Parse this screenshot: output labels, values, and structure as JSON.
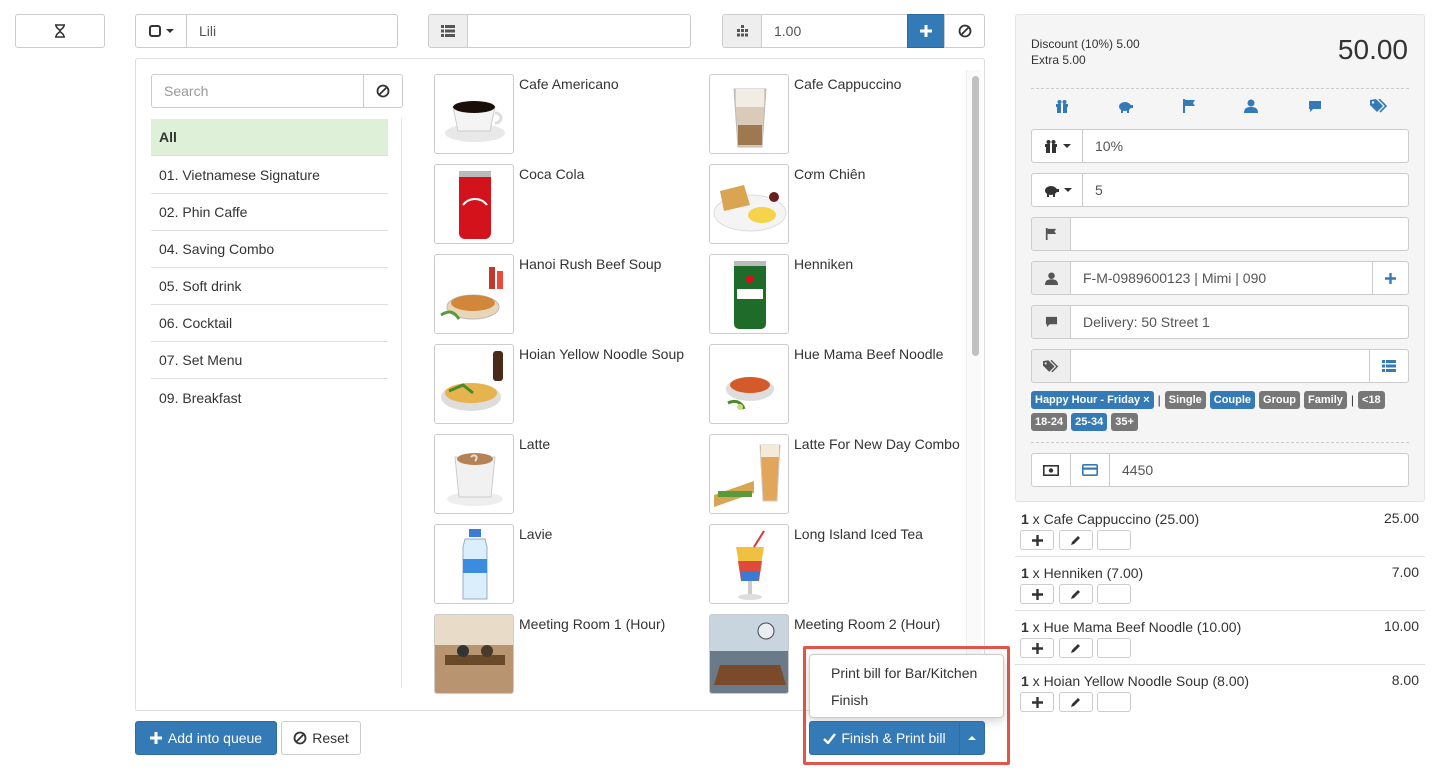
{
  "top": {
    "customer_value": "Lili",
    "table_value": "",
    "quantity_value": "1.00"
  },
  "search": {
    "placeholder": "Search"
  },
  "categories": [
    {
      "label": "All"
    },
    {
      "label": "01. Vietnamese Signature"
    },
    {
      "label": "02. Phin Caffe"
    },
    {
      "label": "04. Saving Combo"
    },
    {
      "label": "05. Soft drink"
    },
    {
      "label": "06. Cocktail"
    },
    {
      "label": "07. Set Menu"
    },
    {
      "label": "09. Breakfast"
    }
  ],
  "products": [
    {
      "name": "Cafe Americano"
    },
    {
      "name": "Cafe Cappuccino"
    },
    {
      "name": "Coca Cola"
    },
    {
      "name": "Cơm Chiên"
    },
    {
      "name": "Hanoi Rush Beef Soup"
    },
    {
      "name": "Henniken"
    },
    {
      "name": "Hoian Yellow Noodle Soup"
    },
    {
      "name": "Hue Mama Beef Noodle"
    },
    {
      "name": "Latte"
    },
    {
      "name": "Latte For New Day Combo"
    },
    {
      "name": "Lavie"
    },
    {
      "name": "Long Island Iced Tea"
    },
    {
      "name": "Meeting Room 1 (Hour)"
    },
    {
      "name": "Meeting Room 2 (Hour)"
    }
  ],
  "bottom": {
    "add_queue_label": "Add into queue",
    "reset_label": "Reset",
    "finish_print_label": "Finish & Print bill",
    "dropdown": [
      "Print bill for Bar/Kitchen",
      "Finish"
    ]
  },
  "summary": {
    "discount_line": "Discount (10%) 5.00",
    "extra_line": "Extra 5.00",
    "total": "50.00",
    "discount_value": "10%",
    "extra_value": "5",
    "flag_value": "",
    "customer_value": "F-M-0989600123 | Mimi | 090",
    "note_value": "Delivery: 50 Street 1",
    "tags_value": "",
    "payment_value": "4450",
    "tags": [
      {
        "label": "Happy Hour - Friday ×",
        "selected": true
      },
      {
        "label": "|",
        "sep": true
      },
      {
        "label": "Single",
        "selected": false
      },
      {
        "label": "Couple",
        "selected": true
      },
      {
        "label": "Group",
        "selected": false
      },
      {
        "label": "Family",
        "selected": false
      },
      {
        "label": "|",
        "sep": true
      },
      {
        "label": "<18",
        "selected": false
      },
      {
        "label": "18-24",
        "selected": false
      },
      {
        "label": "25-34",
        "selected": true
      },
      {
        "label": "35+",
        "selected": false
      }
    ]
  },
  "order_items": [
    {
      "qty": "1",
      "name": " x Cafe Cappuccino (25.00)",
      "amount": "25.00"
    },
    {
      "qty": "1",
      "name": " x Henniken (7.00)",
      "amount": "7.00"
    },
    {
      "qty": "1",
      "name": " x Hue Mama Beef Noodle (10.00)",
      "amount": "10.00"
    },
    {
      "qty": "1",
      "name": " x Hoian Yellow Noodle Soup (8.00)",
      "amount": "8.00"
    }
  ],
  "colors": {
    "primary": "#337ab7",
    "danger": "#d9534f",
    "active_category": "#dff0d8",
    "highlight_border": "#e0564a"
  }
}
